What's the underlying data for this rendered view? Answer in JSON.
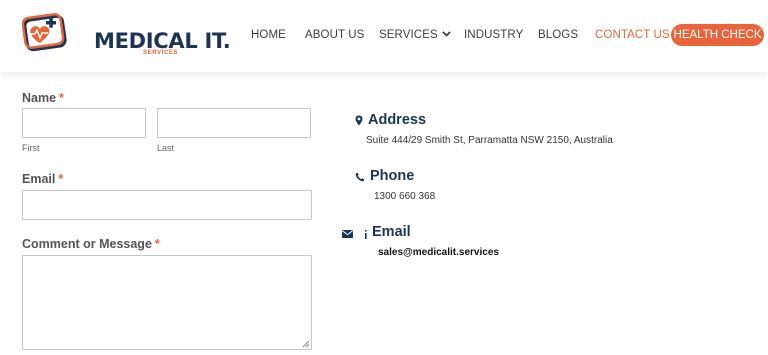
{
  "brand": {
    "name": "MEDICAL IT.",
    "tagline": "SERVICES",
    "accent_color": "#e8643a",
    "navy_color": "#1c3557"
  },
  "nav": {
    "items": [
      {
        "label": "HOME"
      },
      {
        "label": "ABOUT US"
      },
      {
        "label": "SERVICES"
      },
      {
        "label": "INDUSTRY"
      },
      {
        "label": "BLOGS"
      },
      {
        "label": "CONTACT US",
        "active": true
      }
    ],
    "cta_label": "HEALTH CHECK"
  },
  "form": {
    "name_label": "Name",
    "required_mark": "*",
    "first_sublabel": "First",
    "last_sublabel": "Last",
    "first_value": "",
    "last_value": "",
    "email_label": "Email",
    "email_value": "",
    "comment_label": "Comment or Message",
    "comment_value": ""
  },
  "contact": {
    "address_title": "Address",
    "address_text": "Suite 444/29 Smith St, Parramatta NSW 2150, Australia",
    "phone_title": "Phone",
    "phone_text": "1300 660 368",
    "email_title": "Email",
    "email_text": "sales@medicalit.services",
    "icons": [
      "map-marker-icon",
      "phone-icon",
      "envelope-icon"
    ]
  }
}
